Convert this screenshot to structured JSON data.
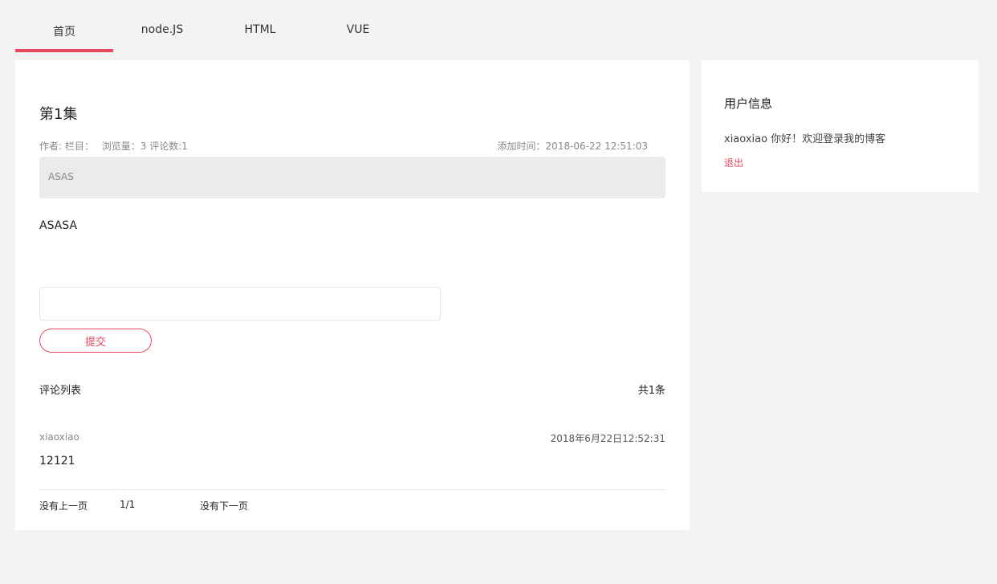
{
  "nav": {
    "tabs": [
      {
        "label": "首页"
      },
      {
        "label": "node.JS"
      },
      {
        "label": "HTML"
      },
      {
        "label": "VUE"
      }
    ],
    "active_index": 0
  },
  "post": {
    "title": "第1集",
    "meta": {
      "author_label": "作者:",
      "column_label": "栏目：",
      "views_label": "浏览量：",
      "views": "3",
      "comments_label": "评论数:",
      "comments": "1",
      "added_label": "添加时间：",
      "added_time": "2018-06-22 12:51:03"
    },
    "description": "ASAS",
    "content": "ASASA"
  },
  "comment_form": {
    "input_value": "",
    "submit_label": "提交"
  },
  "comments": {
    "header_label": "评论列表",
    "total_label": "共1条",
    "items": [
      {
        "user": "xiaoxiao",
        "time": "2018年6月22日12:52:31",
        "text": "12121"
      }
    ]
  },
  "pagination": {
    "prev_label": "没有上一页",
    "page": "1/1",
    "next_label": "没有下一页"
  },
  "sidebar": {
    "title": "用户信息",
    "greeting": "xiaoxiao 你好！欢迎登录我的博客",
    "logout_label": "退出"
  },
  "colors": {
    "accent": "#e84a5f",
    "background": "#f3f3f3",
    "card": "#ffffff",
    "desc_bg": "#ebebeb"
  }
}
